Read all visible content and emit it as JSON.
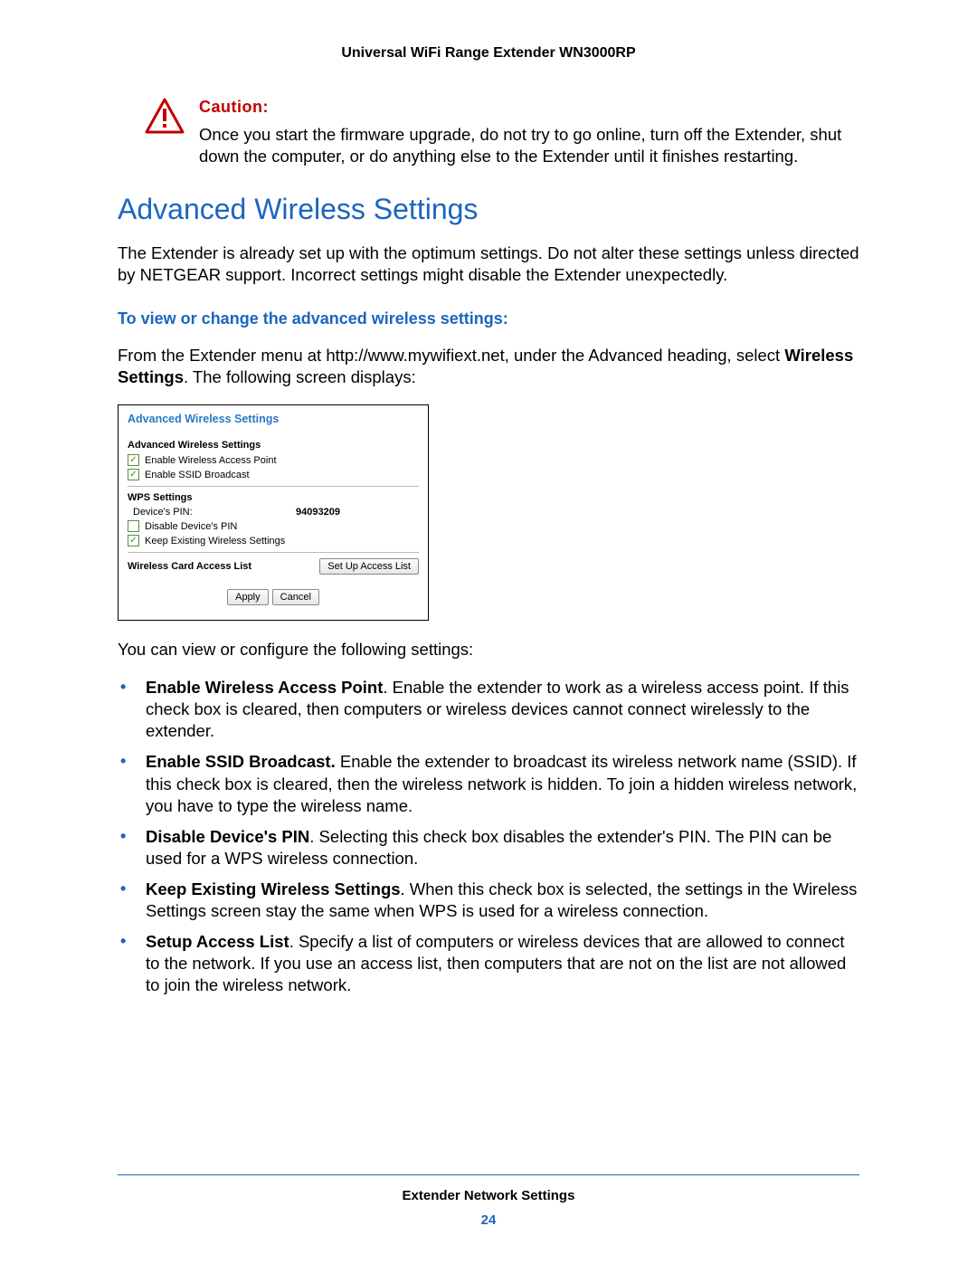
{
  "header": {
    "title": "Universal WiFi Range Extender WN3000RP"
  },
  "caution": {
    "heading": "Caution:",
    "body": "Once you start the firmware upgrade, do not try to go online, turn off the Extender, shut down the computer, or do anything else to the Extender until it finishes restarting."
  },
  "section_title": "Advanced Wireless Settings",
  "intro_para": "The Extender is already set up with the optimum settings. Do not alter these settings unless directed by NETGEAR support. Incorrect settings might disable the Extender unexpectedly.",
  "subhead": "To view or change the advanced wireless settings:",
  "menu_para_pre": "From the Extender menu at http://www.mywifiext.net, under the Advanced heading, select ",
  "menu_para_bold": "Wireless Settings",
  "menu_para_post": ". The following screen displays:",
  "panel": {
    "title": "Advanced Wireless Settings",
    "group1_heading": "Advanced Wireless Settings",
    "enable_ap": "Enable Wireless Access Point",
    "enable_ssid": "Enable SSID Broadcast",
    "wps_heading": "WPS Settings",
    "pin_label": "Device's PIN:",
    "pin_value": "94093209",
    "disable_pin": "Disable Device's PIN",
    "keep_existing": "Keep Existing Wireless Settings",
    "acl_label": "Wireless Card Access List",
    "setup_btn": "Set Up Access List",
    "apply_btn": "Apply",
    "cancel_btn": "Cancel"
  },
  "para_after_panel": "You can view or configure the following settings:",
  "features": [
    {
      "bold": "Enable Wireless Access Point",
      "text": ". Enable the extender to work as a wireless access point. If this check box is cleared, then computers or wireless devices cannot connect wirelessly to the extender."
    },
    {
      "bold": "Enable SSID Broadcast.",
      "text": " Enable the extender to broadcast its wireless network name (SSID). If this check box is cleared, then the wireless network is hidden. To join a hidden wireless network, you have to type the wireless name."
    },
    {
      "bold": "Disable Device's PIN",
      "text": ". Selecting this check box disables the extender's PIN. The PIN can be used for a WPS wireless connection."
    },
    {
      "bold": "Keep Existing Wireless Settings",
      "text": ". When this check box is selected, the settings in the Wireless Settings screen stay the same when WPS is used for a wireless connection."
    },
    {
      "bold": "Setup Access List",
      "text": ". Specify a list of computers or wireless devices that are allowed to connect to the network. If you use an access list, then computers that are not on the list are not allowed to join the wireless network."
    }
  ],
  "footer": {
    "title": "Extender Network Settings",
    "page": "24"
  }
}
